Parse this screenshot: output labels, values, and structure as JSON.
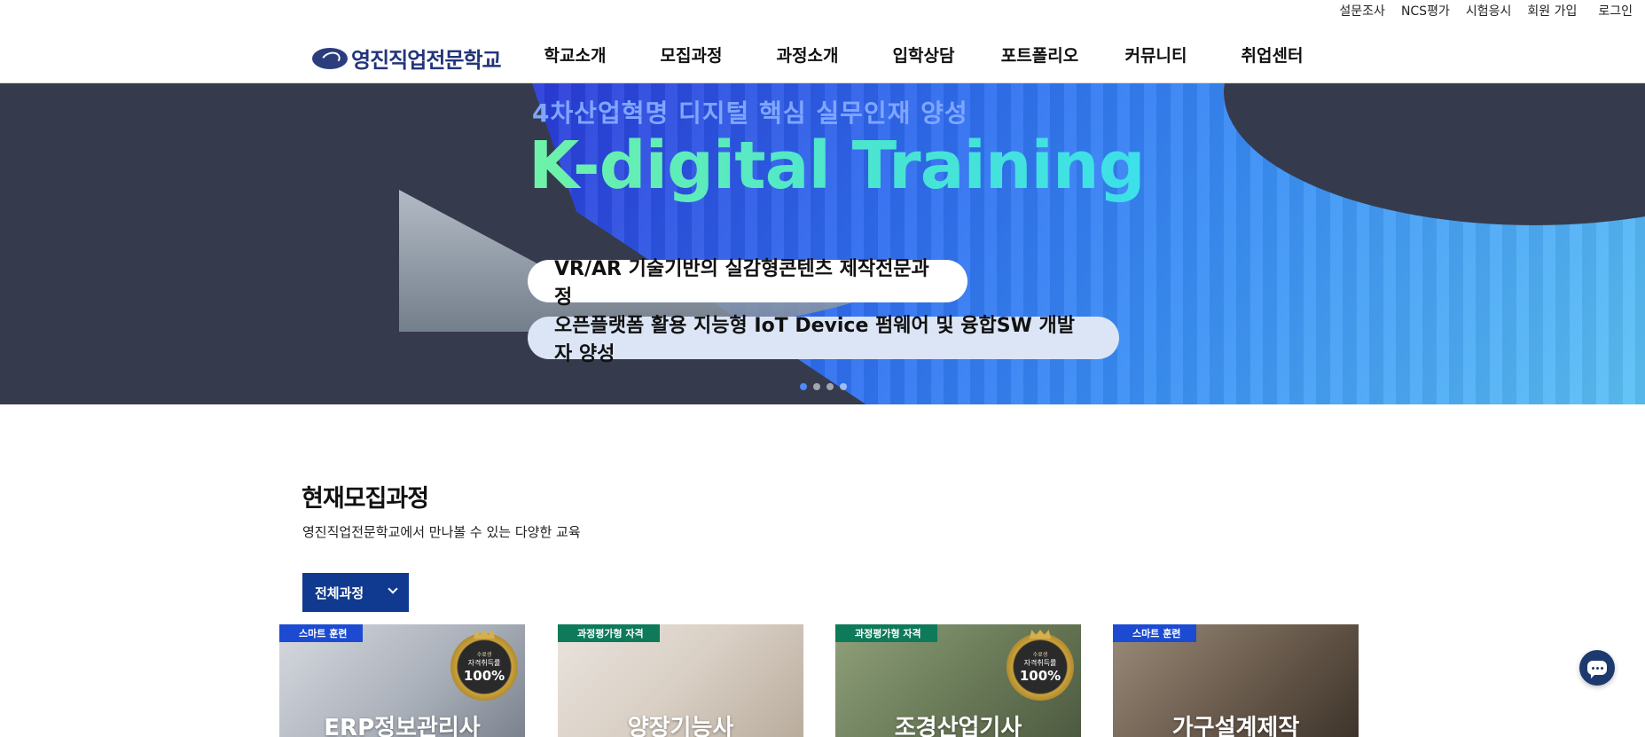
{
  "util_nav": {
    "survey": "설문조사",
    "ncs": "NCS평가",
    "exam": "시험응시",
    "signup": "회원 가입",
    "login": "로그인"
  },
  "logo": {
    "text": "영진직업전문학교",
    "icon": "school-logo-icon"
  },
  "gnb": {
    "items": [
      {
        "label": "학교소개"
      },
      {
        "label": "모집과정"
      },
      {
        "label": "과정소개"
      },
      {
        "label": "입학상담"
      },
      {
        "label": "포트폴리오"
      },
      {
        "label": "커뮤니티"
      },
      {
        "label": "취업센터"
      }
    ]
  },
  "hero": {
    "subtitle": "4차산업혁명 디지털 핵심 실무인재 양성",
    "title": "K-digital Training",
    "pill_1": "VR/AR 기술기반의 실감형콘텐츠 제작전문과정",
    "pill_2": "오픈플랫폼 활용 지능형 IoT Device 펌웨어 및 융합SW 개발자 양성",
    "slides_total": 4,
    "active_slide": 1,
    "accent": "#4e8bff"
  },
  "section": {
    "title": "현재모집과정",
    "description": "영진직업전문학교에서 만나볼 수 있는 다양한 교육",
    "filter_label": "전체과정"
  },
  "cards": [
    {
      "tag": "스마트 훈련",
      "name": "ERP정보관리사",
      "badge": true
    },
    {
      "tag": "과정평가형 자격",
      "name": "양장기능사",
      "badge": false
    },
    {
      "tag": "과정평가형 자격",
      "name": "조경산업기사",
      "badge": true
    },
    {
      "tag": "스마트 훈련",
      "name": "가구설계제작",
      "badge": false
    }
  ],
  "badge": {
    "line1": "수료생",
    "line2": "자격취득률",
    "line3": "100%"
  },
  "chat": {
    "icon": "chat-icon"
  }
}
